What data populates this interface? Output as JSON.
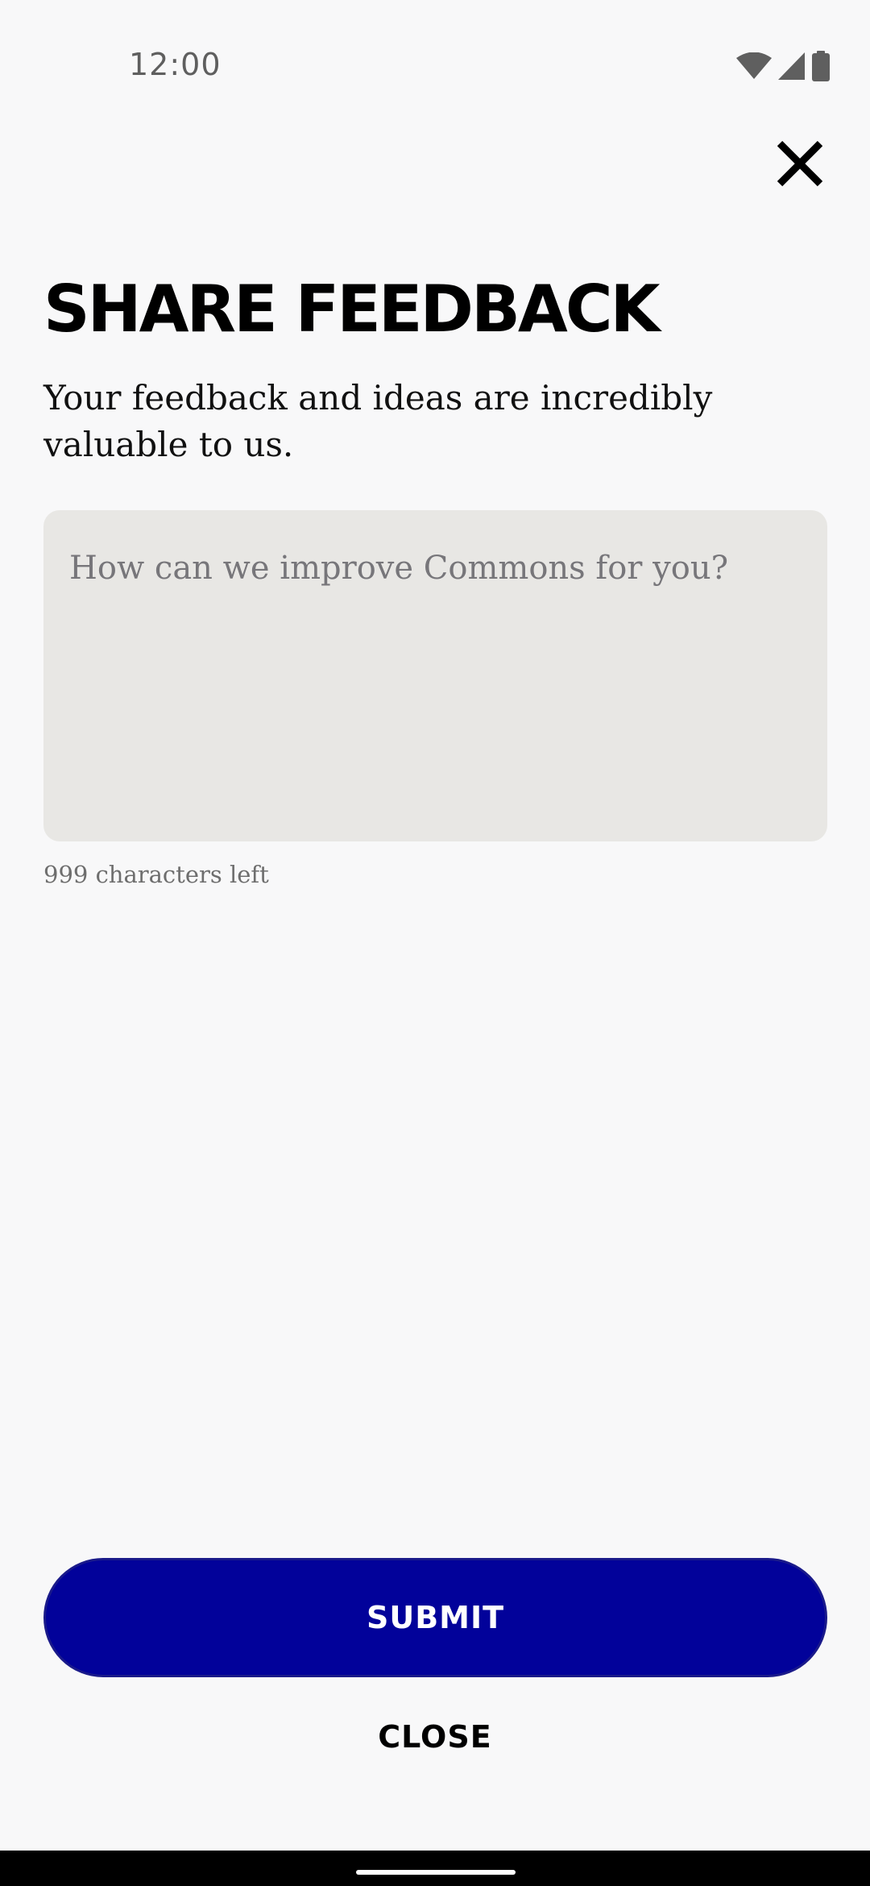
{
  "status_bar": {
    "time": "12:00",
    "icons": [
      "wifi-icon",
      "cell-signal-icon",
      "battery-icon"
    ]
  },
  "header": {
    "close_icon": "close-icon"
  },
  "main": {
    "title": "SHARE FEEDBACK",
    "subtitle": "Your feedback and ideas are incredibly valuable to us.",
    "feedback_input": {
      "value": "",
      "placeholder": "How can we improve Commons for you?"
    },
    "char_count": "999 characters left"
  },
  "actions": {
    "submit_label": "SUBMIT",
    "close_label": "CLOSE"
  },
  "colors": {
    "background": "#f8f8f9",
    "accent": "#02029a",
    "input_background": "#e8e7e4"
  }
}
